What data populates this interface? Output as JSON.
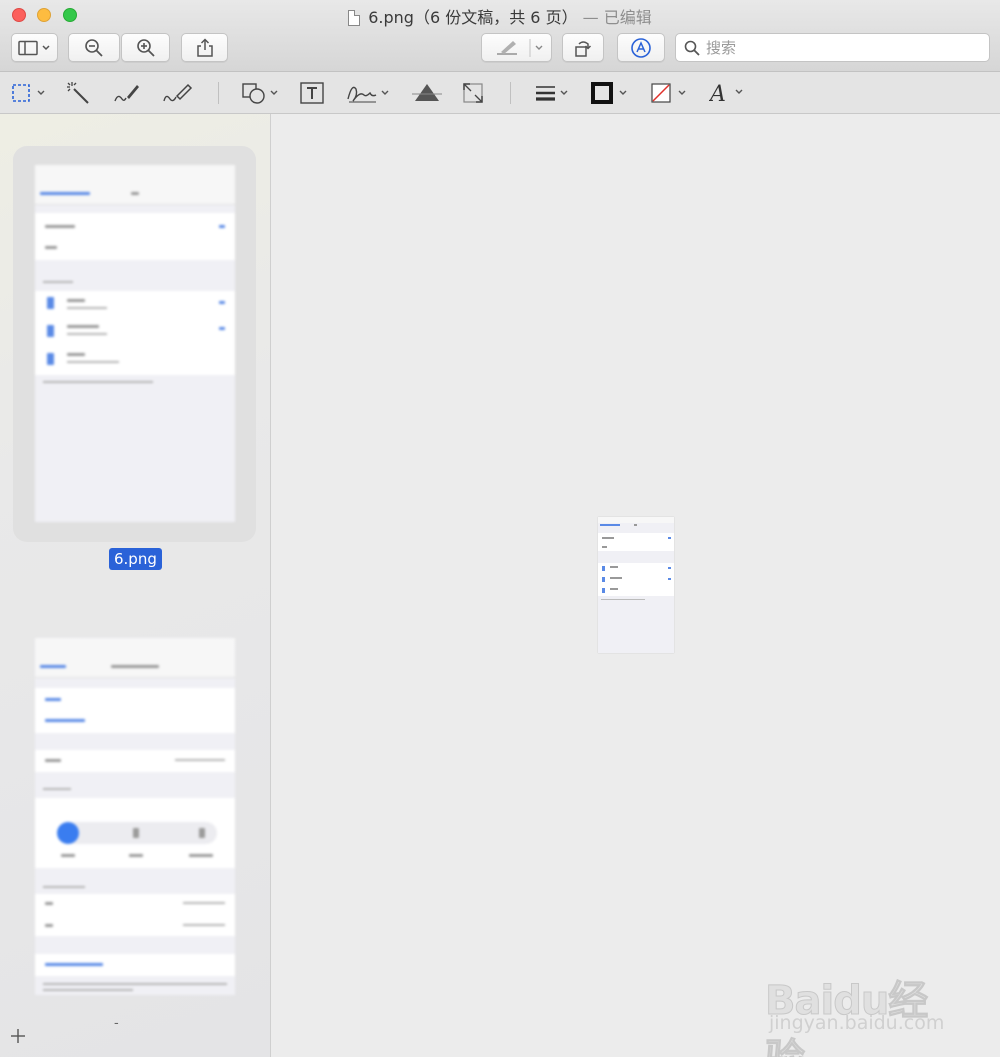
{
  "window": {
    "title": "6.png（6 份文稿，共 6 页）",
    "edited_label": "— 已编辑"
  },
  "toolbar": {
    "search_placeholder": "搜索",
    "accent_color": "#2a62d8"
  },
  "markup_tools": [
    "selection-tool",
    "instant-alpha",
    "sketch",
    "draw",
    "shapes",
    "text",
    "sign",
    "adjust-color",
    "adjust-size",
    "shape-style",
    "border-color",
    "fill-color",
    "text-style"
  ],
  "sidebar": {
    "thumbnails": [
      {
        "label": "6.png",
        "selected": true
      },
      {
        "label": "-",
        "selected": false
      }
    ]
  },
  "watermark": {
    "logo": "Baidu经验",
    "url": "jingyan.baidu.com"
  }
}
